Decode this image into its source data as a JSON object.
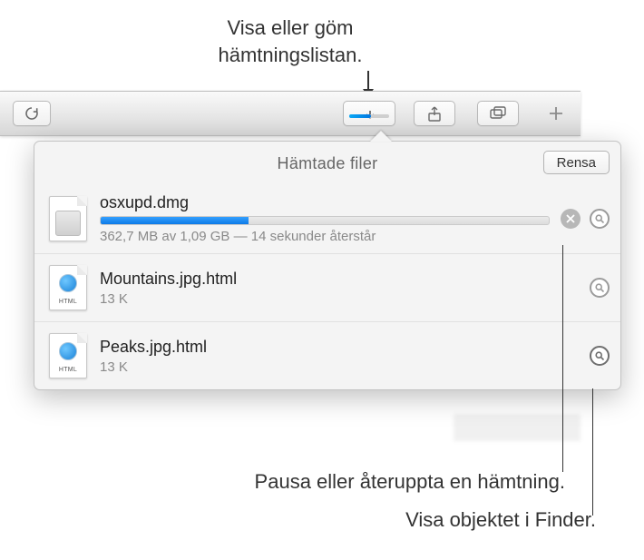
{
  "callouts": {
    "top": "Visa eller göm hämtningslistan.",
    "pause": "Pausa eller återuppta en hämtning.",
    "finder": "Visa objektet i Finder."
  },
  "toolbar": {
    "reload_name": "reload",
    "downloads_name": "downloads",
    "share_name": "share",
    "tabs_name": "tabs",
    "add_name": "new-tab"
  },
  "popover": {
    "title": "Hämtade filer",
    "clear": "Rensa"
  },
  "downloads": [
    {
      "name": "osxupd.dmg",
      "status": "362,7 MB av 1,09 GB — 14 sekunder återstår",
      "progress": true,
      "icon": "dmg",
      "has_stop": true
    },
    {
      "name": "Mountains.jpg.html",
      "status": "13 K",
      "progress": false,
      "icon": "html",
      "has_stop": false
    },
    {
      "name": "Peaks.jpg.html",
      "status": "13 K",
      "progress": false,
      "icon": "html",
      "has_stop": false
    }
  ]
}
